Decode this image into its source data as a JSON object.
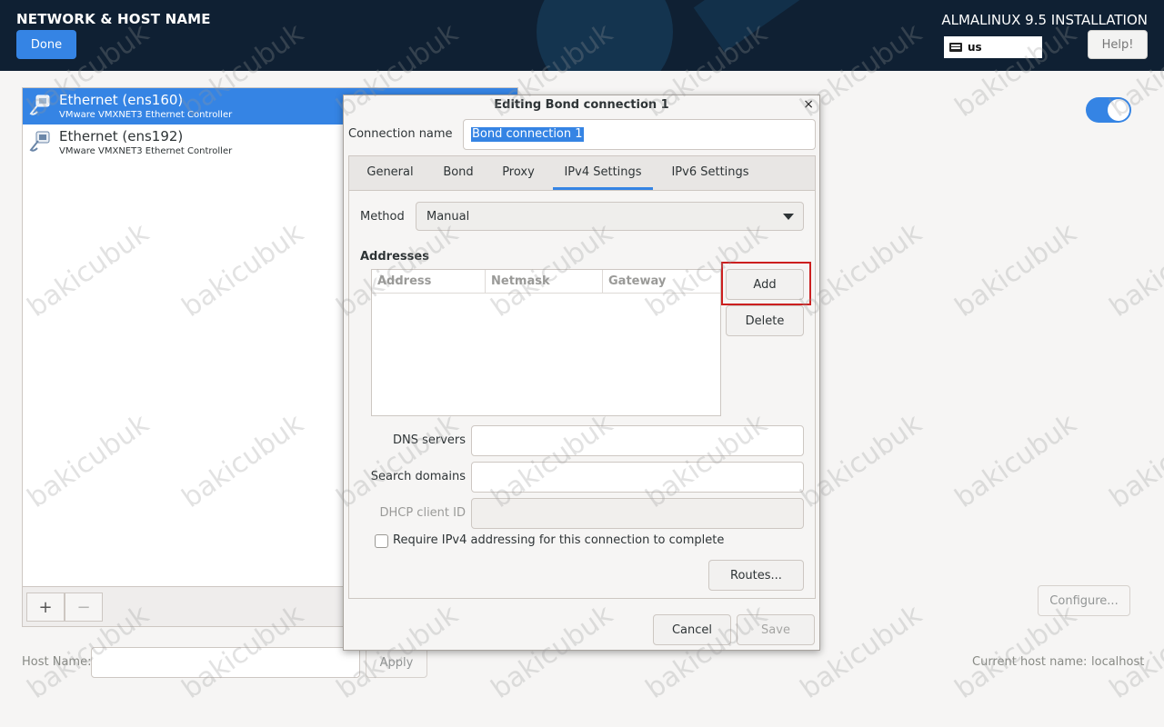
{
  "header": {
    "title": "NETWORK & HOST NAME",
    "done_label": "Done",
    "installer_title": "ALMALINUX 9.5 INSTALLATION",
    "keyboard_layout": "us",
    "help_label": "Help!"
  },
  "devices": [
    {
      "name": "Ethernet (ens160)",
      "description": "VMware VMXNET3 Ethernet Controller",
      "selected": true
    },
    {
      "name": "Ethernet (ens192)",
      "description": "VMware VMXNET3 Ethernet Controller",
      "selected": false
    }
  ],
  "toolbar": {
    "add_label": "+",
    "remove_label": "−"
  },
  "device_switch": {
    "on": true
  },
  "configure_label": "Configure...",
  "host": {
    "label": "Host Name:",
    "value": "",
    "apply_label": "Apply",
    "current_label": "Current host name:",
    "current_value": "localhost"
  },
  "dialog": {
    "title": "Editing Bond connection 1",
    "close_glyph": "×",
    "connection_name_label": "Connection name",
    "connection_name_value": "Bond connection 1",
    "tabs": [
      "General",
      "Bond",
      "Proxy",
      "IPv4 Settings",
      "IPv6 Settings"
    ],
    "active_tab": "IPv4 Settings",
    "method_label": "Method",
    "method_value": "Manual",
    "addresses_label": "Addresses",
    "columns": [
      "Address",
      "Netmask",
      "Gateway"
    ],
    "add_label": "Add",
    "delete_label": "Delete",
    "dns_label": "DNS servers",
    "search_label": "Search domains",
    "dhcp_label": "DHCP client ID",
    "require_label": "Require IPv4 addressing for this connection to complete",
    "routes_label": "Routes...",
    "cancel_label": "Cancel",
    "save_label": "Save"
  },
  "watermark": "bakicubuk",
  "colors": {
    "accent": "#3584e4",
    "header_bg": "#0f2033",
    "highlight": "#cc1f1f"
  }
}
